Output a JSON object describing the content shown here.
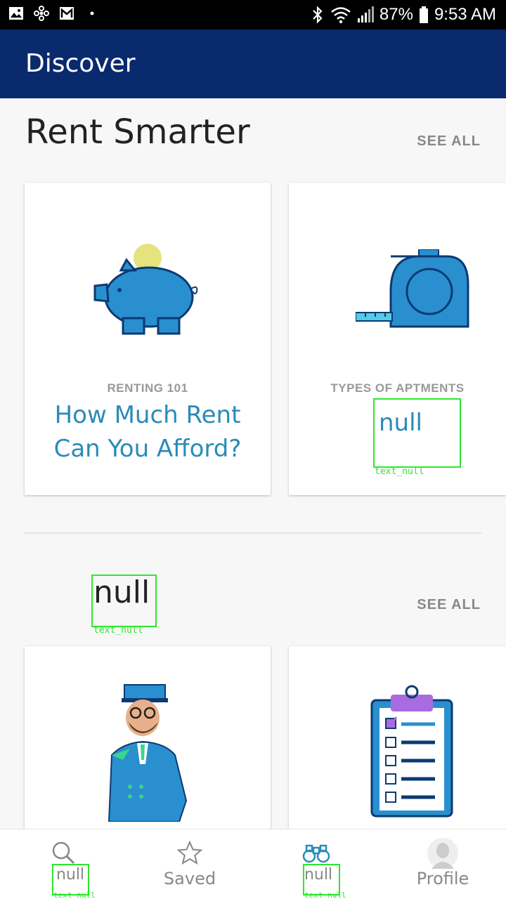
{
  "status_bar": {
    "battery": "87%",
    "time": "9:53 AM",
    "left_icons": [
      "image-icon",
      "fan-icon",
      "mail-icon",
      "dot-icon"
    ],
    "right_icons": [
      "bluetooth-icon",
      "wifi-icon",
      "signal-icon",
      "battery-icon"
    ]
  },
  "appbar": {
    "title": "Discover"
  },
  "section1": {
    "title": "Rent Smarter",
    "see_all": "SEE ALL",
    "cards": [
      {
        "category": "RENTING 101",
        "title_line1": "How Much Rent",
        "title_line2": "Can You Afford?",
        "image": "piggy-bank-icon"
      },
      {
        "category": "TYPES OF APTMENTS",
        "title": "null",
        "caption": "text_null",
        "image": "tape-measure-icon"
      }
    ]
  },
  "section2": {
    "title": "null",
    "caption": "text_null",
    "see_all": "SEE ALL",
    "cards": [
      {
        "image": "doorman-illustration"
      },
      {
        "image": "clipboard-checklist-icon"
      }
    ]
  },
  "bottom_nav": {
    "items": [
      {
        "label": "null",
        "caption": "text_null",
        "icon": "search-icon"
      },
      {
        "label": "Saved",
        "icon": "star-icon"
      },
      {
        "label": "null",
        "caption": "text_null",
        "icon": "binoculars-icon"
      },
      {
        "label": "Profile",
        "icon": "profile-avatar-icon"
      }
    ]
  },
  "colors": {
    "appbar": "#0a2a6e",
    "accent": "#2a8bb8",
    "marker": "#2ee62e"
  }
}
